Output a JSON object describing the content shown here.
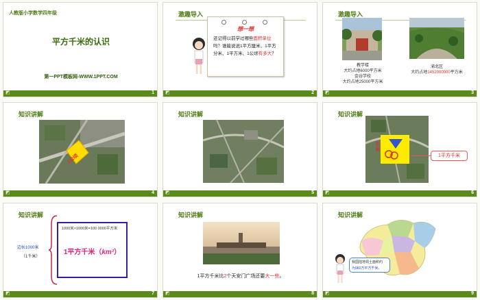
{
  "slides": [
    {
      "number": "1",
      "grade_label": "人教版小学数学四年级",
      "title": "平方千米的认识",
      "footer": "第一PPT模板网-WWW.1PPT.COM"
    },
    {
      "number": "2",
      "header": "激趣导入",
      "note_title": "想一想",
      "text_a": "还记得以前学过哪些",
      "text_red1": "面积单位",
      "text_b": "吗？谁能说说1平方厘米、1平方分米、1平方米、1公顷",
      "text_red2": "有多大",
      "text_c": "？"
    },
    {
      "number": "3",
      "header": "激趣导入",
      "cap1a": "教学楼",
      "cap1b": "大约占地6000平方米",
      "cap1c": "金谷学校",
      "cap1d": "大约占地25000平方米",
      "cap2a": "渝北区",
      "cap2b_pre": "大约占地",
      "cap2b_red": "1452000000",
      "cap2b_post": "平方米"
    },
    {
      "number": "4",
      "header": "知识讲解",
      "sq_label": "1公顷"
    },
    {
      "number": "5",
      "header": "知识讲解"
    },
    {
      "number": "6",
      "header": "知识讲解",
      "side_label": "1千米",
      "callout": "1平方千米"
    },
    {
      "number": "7",
      "header": "知识讲解",
      "side_a": "边长1000米",
      "side_b": "（1千米）",
      "formula": "1000米×1000米=100 0000平方米",
      "big_pre": "1平方千米（",
      "big_unit": "km²",
      "big_post": "）"
    },
    {
      "number": "8",
      "header": "知识讲解",
      "cap_pre": "1平方千米比",
      "cap_red1": "2",
      "cap_mid": "个天安门广场还要",
      "cap_red2": "大一些",
      "cap_post": "。"
    },
    {
      "number": "9",
      "header": "知识讲解",
      "bubble_a": "我国陆地领土面积约",
      "bubble_b": "为960万平方千米。"
    }
  ],
  "bar_icon": "ppt-icon",
  "colors": {
    "accent_green": "#4d7c12",
    "bar_green": "#5a8a1a",
    "red": "#e62b2b",
    "callout_red": "#e05a5a"
  }
}
